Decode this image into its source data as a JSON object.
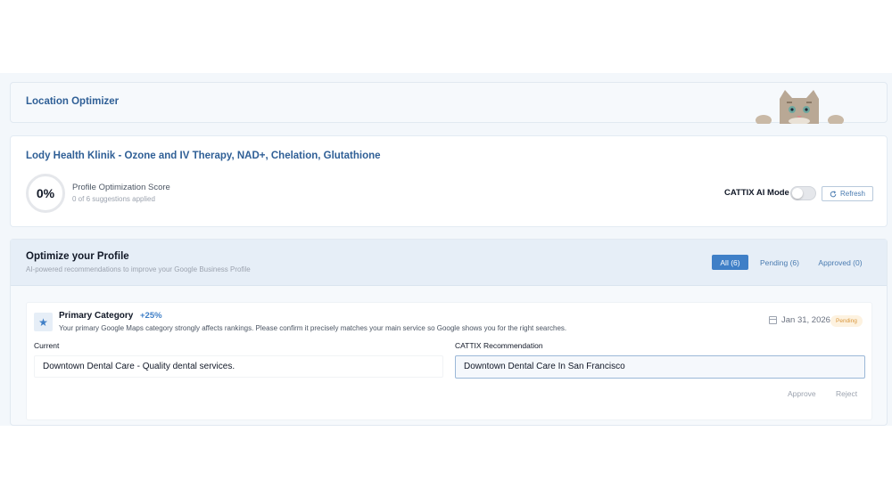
{
  "location": {
    "title": "Location Optimizer"
  },
  "business": {
    "name": "Lody Health Klinik - Ozone and IV Therapy, NAD+, Chelation, Glutathione",
    "score": "0%",
    "score_label": "Profile Optimization Score",
    "score_sub": "0 of 6 suggestions applied",
    "ai_mode_label": "CATTIX AI Mode",
    "ai_mode_on": false,
    "refresh_label": "Refresh"
  },
  "optimize": {
    "title": "Optimize your Profile",
    "subtitle": "AI-powered recommendations to improve your Google Business Profile",
    "tabs": [
      {
        "label": "All (6)",
        "active": true
      },
      {
        "label": "Pending (6)",
        "active": false
      },
      {
        "label": "Approved (0)",
        "active": false
      }
    ]
  },
  "recommendation": {
    "icon": "star-icon",
    "title": "Primary Category",
    "impact": "+25%",
    "description": "Your primary Google Maps category strongly affects rankings. Please confirm it precisely matches your main service so Google shows you for the right searches.",
    "date": "Jan 31, 2026",
    "status": "Pending",
    "current_label": "Current",
    "current_value": "Downtown Dental Care - Quality dental services.",
    "recommendation_label": "CATTIX Recommendation",
    "recommendation_value": "Downtown Dental Care In San Francisco",
    "approve_label": "Approve",
    "reject_label": "Reject"
  },
  "colors": {
    "accent": "#3f7fc7",
    "title_blue": "#2f5f96",
    "pending": "#d9973d"
  }
}
